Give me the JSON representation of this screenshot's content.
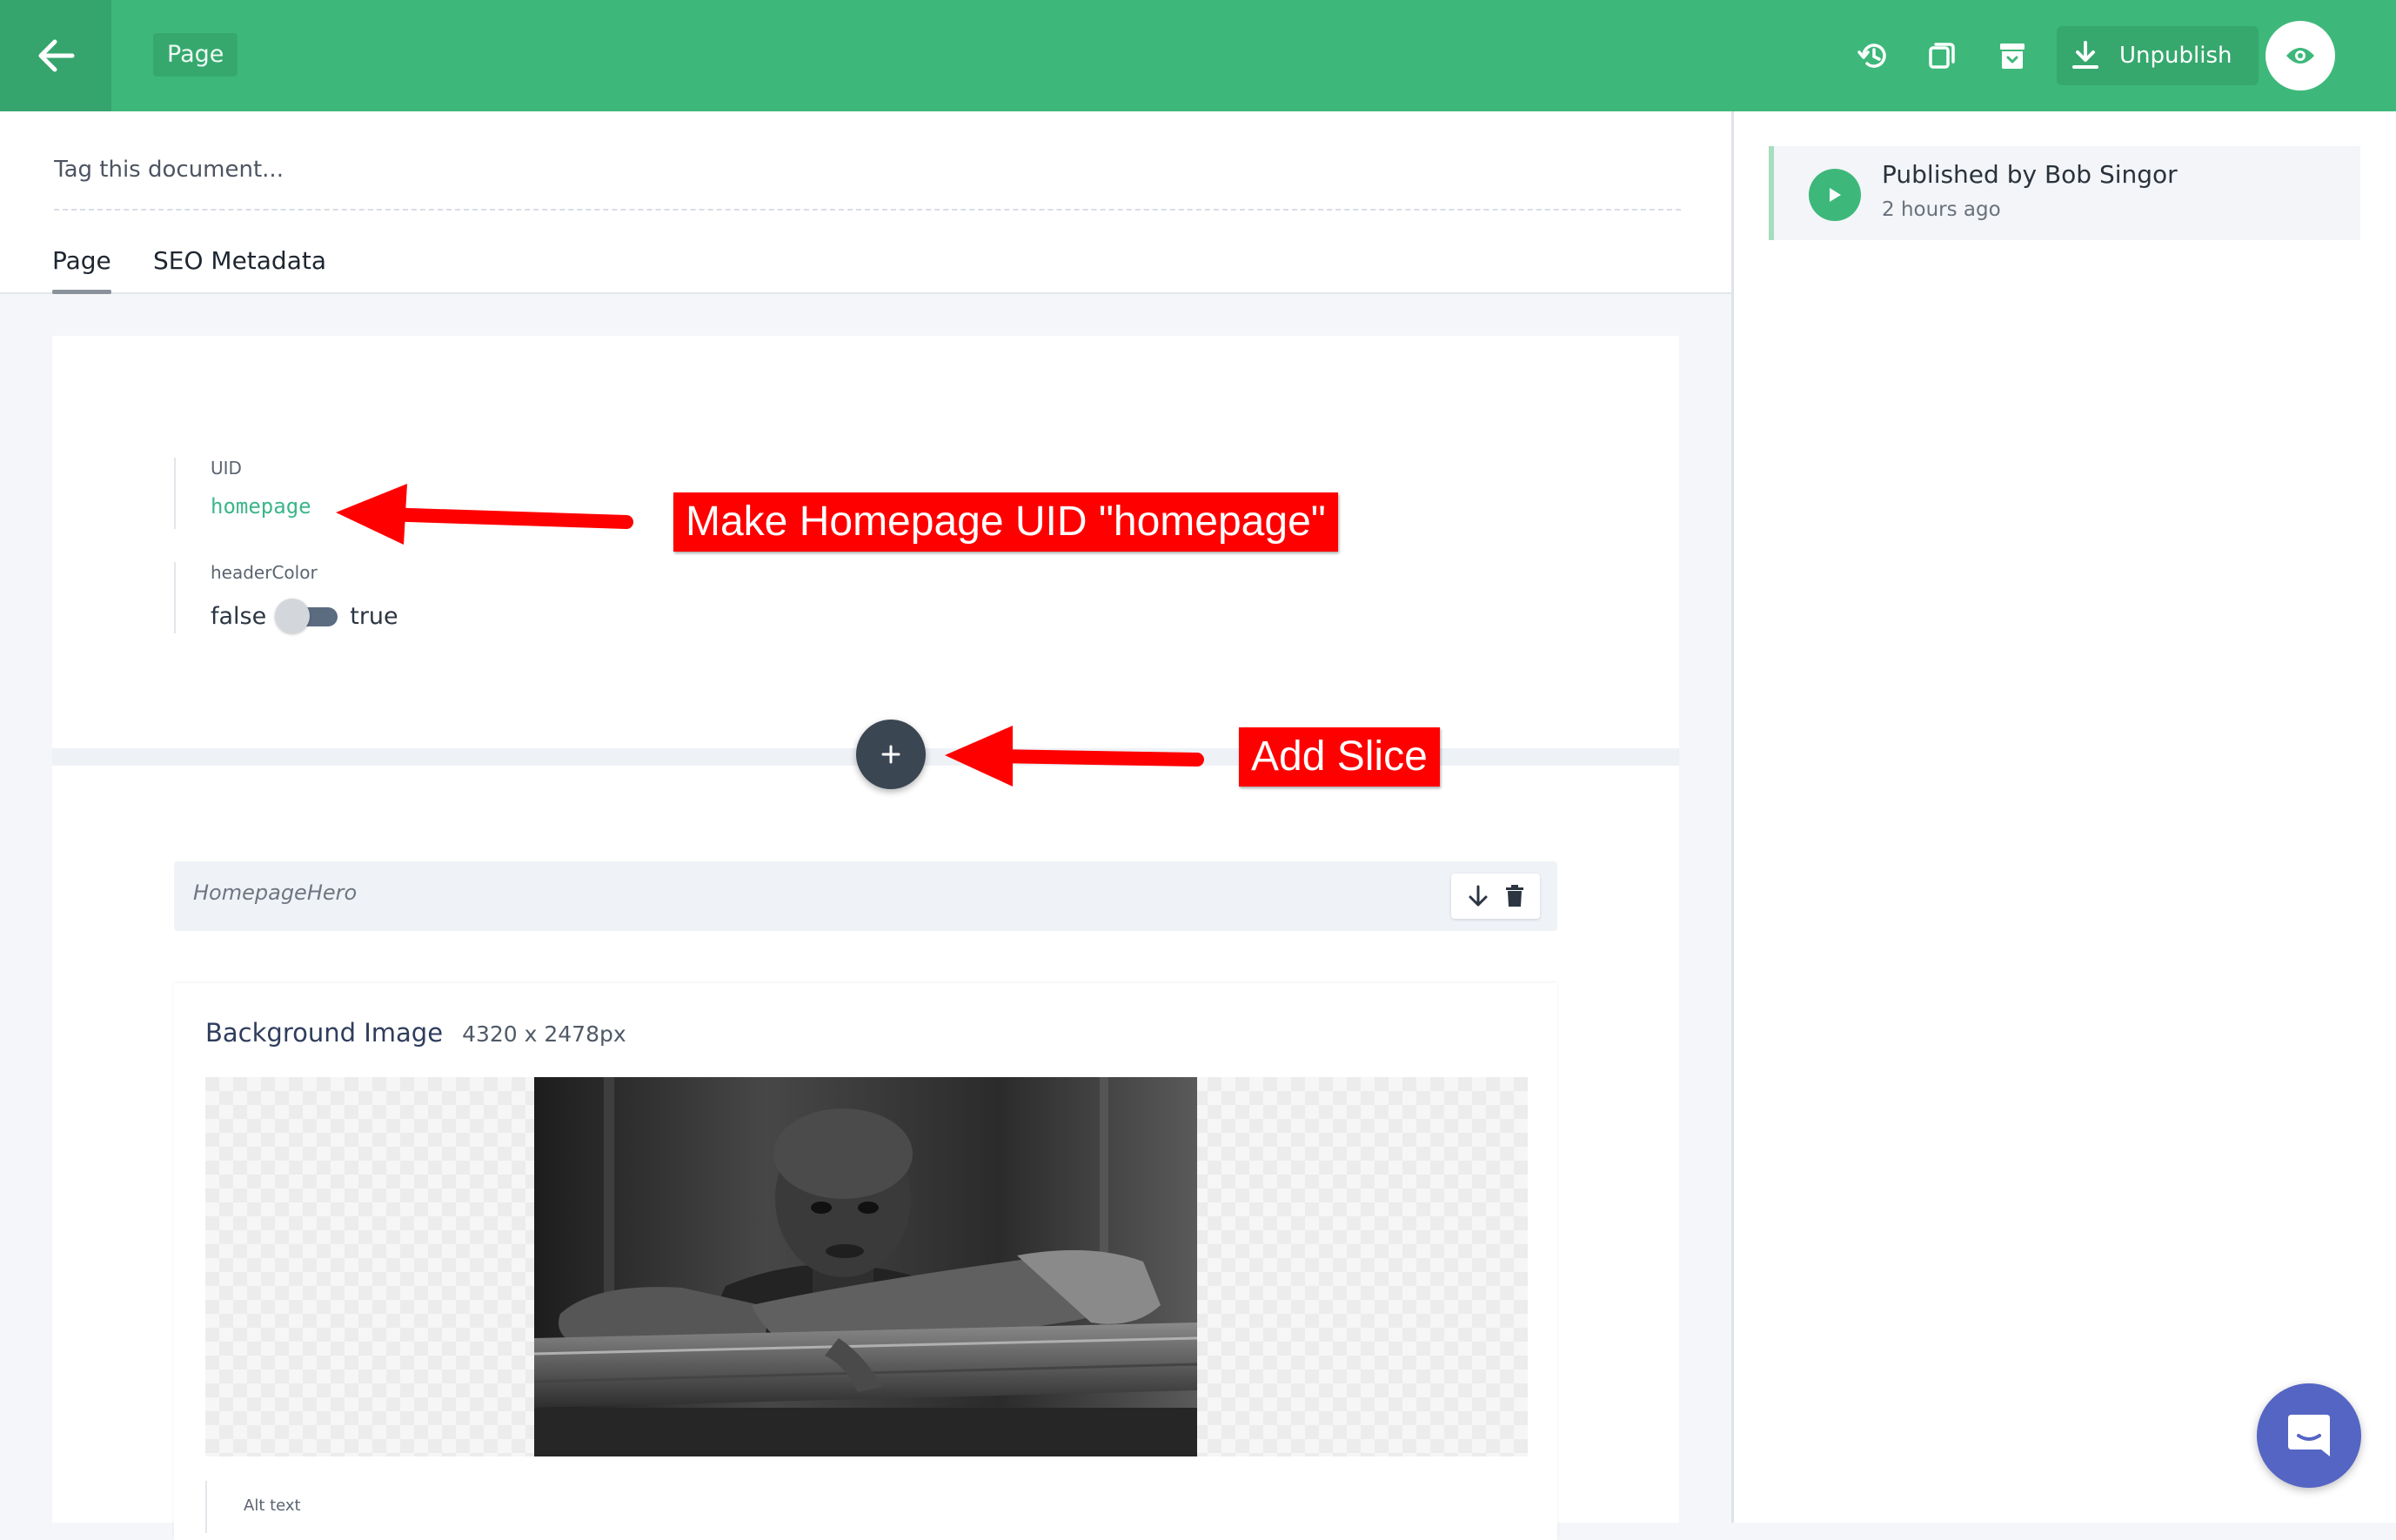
{
  "topbar": {
    "doc_type": "Page",
    "unpublish_label": "Unpublish"
  },
  "document": {
    "tag_placeholder": "Tag this document...",
    "tabs": [
      {
        "label": "Page",
        "active": true
      },
      {
        "label": "SEO Metadata",
        "active": false
      }
    ]
  },
  "fields": {
    "uid": {
      "label": "UID",
      "value": "homepage"
    },
    "header_color": {
      "label": "headerColor",
      "false_label": "false",
      "true_label": "true",
      "value": false
    }
  },
  "slice": {
    "name": "HomepageHero",
    "image_field": {
      "title": "Background Image",
      "dimensions": "4320 x 2478px",
      "alt_label": "Alt text"
    }
  },
  "annotations": {
    "uid_note": "Make Homepage UID \"homepage\"",
    "slice_note": "Add Slice"
  },
  "status": {
    "title": "Published by Bob Singor",
    "time": "2 hours ago"
  },
  "colors": {
    "brand_green": "#3db87a",
    "annotation_red": "#ff0000",
    "chat_blue": "#5565c4"
  },
  "icons": {
    "back": "arrow-left-icon",
    "history": "history-icon",
    "duplicate": "copy-icon",
    "archive": "archive-icon",
    "unpublish": "download-icon",
    "preview": "eye-icon",
    "add": "plus-icon",
    "move_down": "arrow-down-icon",
    "delete": "trash-icon",
    "published": "play-icon",
    "chat": "chat-icon"
  }
}
